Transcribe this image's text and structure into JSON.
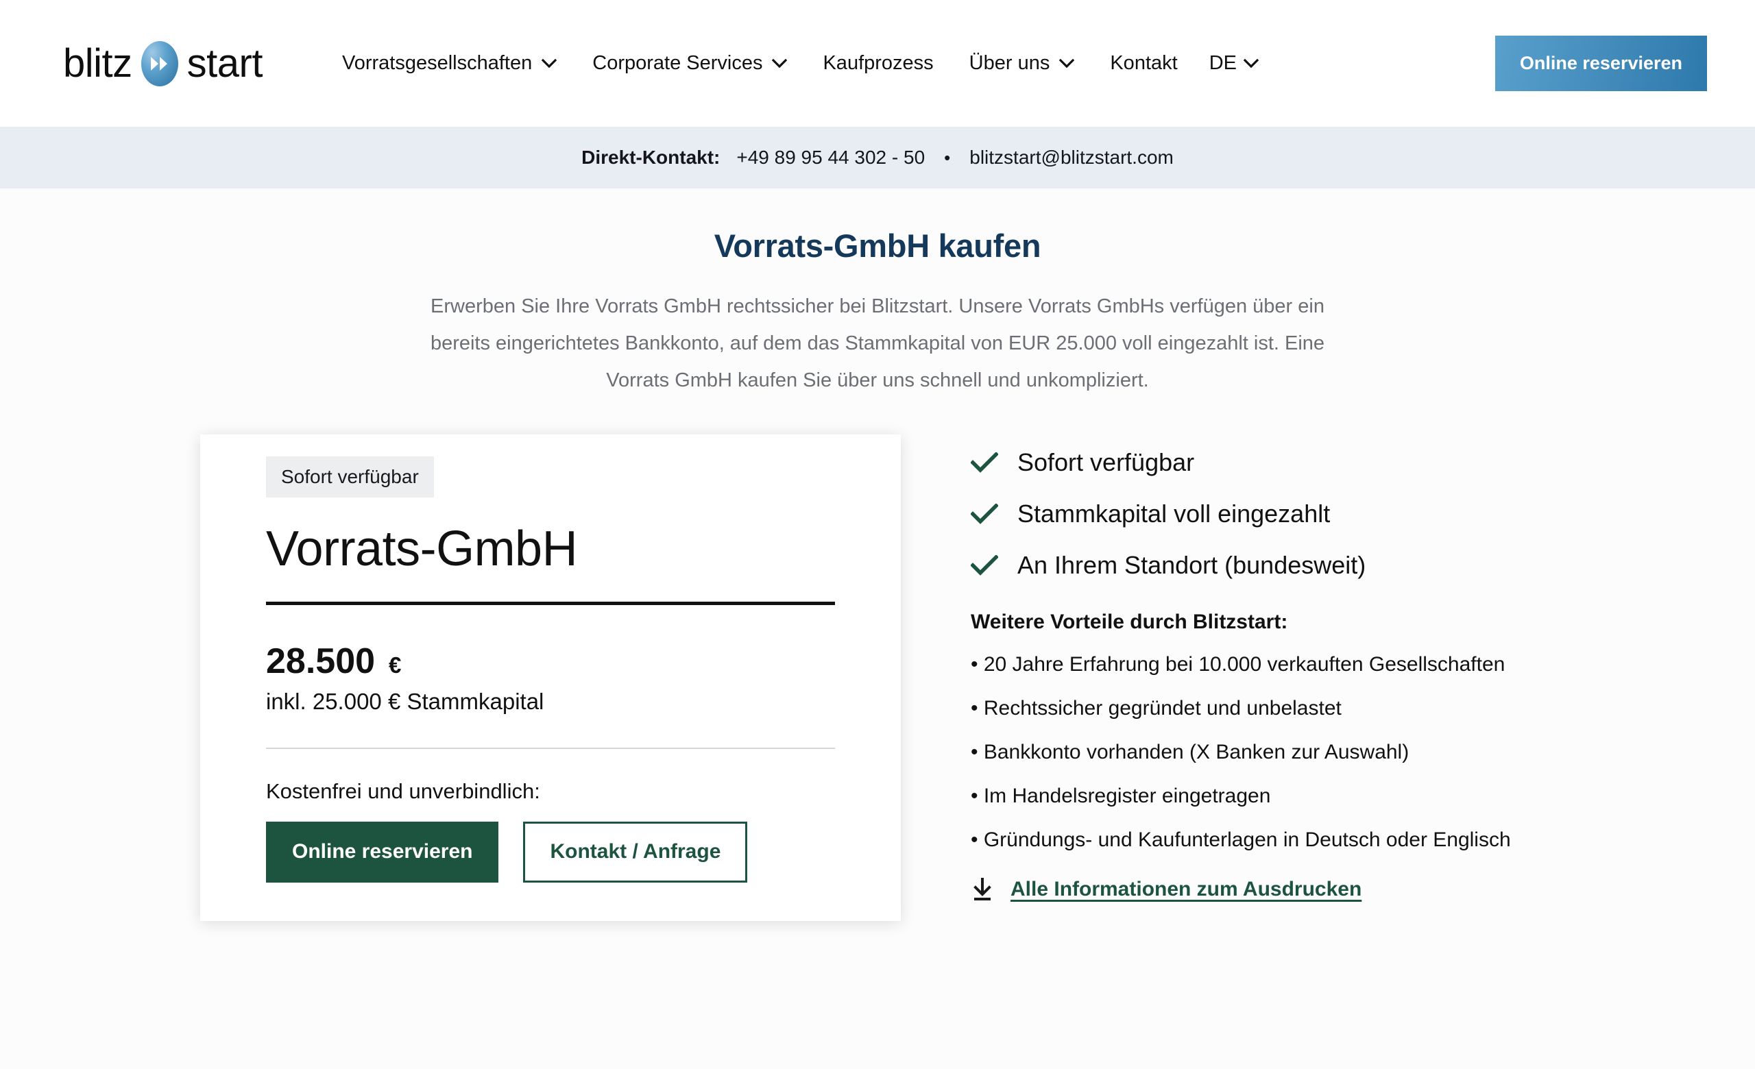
{
  "header": {
    "logo": {
      "text_left": "blitz",
      "text_right": "start",
      "mark_icon": "double-chevron-right-icon"
    },
    "nav": [
      {
        "label": "Vorratsgesellschaften",
        "has_dropdown": true
      },
      {
        "label": "Corporate Services",
        "has_dropdown": true
      },
      {
        "label": "Kaufprozess",
        "has_dropdown": false
      },
      {
        "label": "Über uns",
        "has_dropdown": true
      },
      {
        "label": "Kontakt",
        "has_dropdown": false
      }
    ],
    "language": {
      "label": "DE",
      "has_dropdown": true
    },
    "cta_label": "Online reservieren",
    "cta_color": "#2e79ac"
  },
  "contactbar": {
    "label": "Direkt-Kontakt:",
    "phone": "+49 89 95 44 302 - 50",
    "separator": "•",
    "email": "blitzstart@blitzstart.com",
    "background": "#e8edf4"
  },
  "main": {
    "title": "Vorrats-GmbH kaufen",
    "title_color": "#14395b",
    "description": "Erwerben Sie Ihre Vorrats GmbH rechtssicher bei Blitzstart. Unsere Vorrats GmbHs verfügen über ein bereits eingerichtetes Bankkonto, auf dem das Stammkapital von EUR 25.000 voll eingezahlt ist. Eine Vorrats GmbH kaufen Sie über uns schnell und unkompliziert."
  },
  "card": {
    "badge": "Sofort verfügbar",
    "title": "Vorrats-GmbH",
    "price_amount": "28.500",
    "price_currency": "€",
    "price_note": "inkl. 25.000 € Stammkapital",
    "cta_label": "Kostenfrei und unverbindlich:",
    "primary_button": "Online reservieren",
    "secondary_button": "Kontakt / Anfrage",
    "accent_color": "#1d5440"
  },
  "side": {
    "checks": [
      "Sofort verfügbar",
      "Stammkapital voll eingezahlt",
      "An Ihrem Standort (bundesweit)"
    ],
    "check_color": "#1d5440",
    "benefits_heading": "Weitere Vorteile durch Blitzstart:",
    "benefits": [
      "• 20 Jahre Erfahrung bei 10.000 verkauften Gesellschaften",
      "• Rechtssicher gegründet und unbelastet",
      "• Bankkonto vorhanden (X Banken zur Auswahl)",
      "• Im Handelsregister eingetragen",
      "• Gründungs- und Kaufunterlagen in Deutsch oder Englisch"
    ],
    "download_label": "Alle Informationen zum Ausdrucken",
    "download_icon": "download-icon"
  }
}
